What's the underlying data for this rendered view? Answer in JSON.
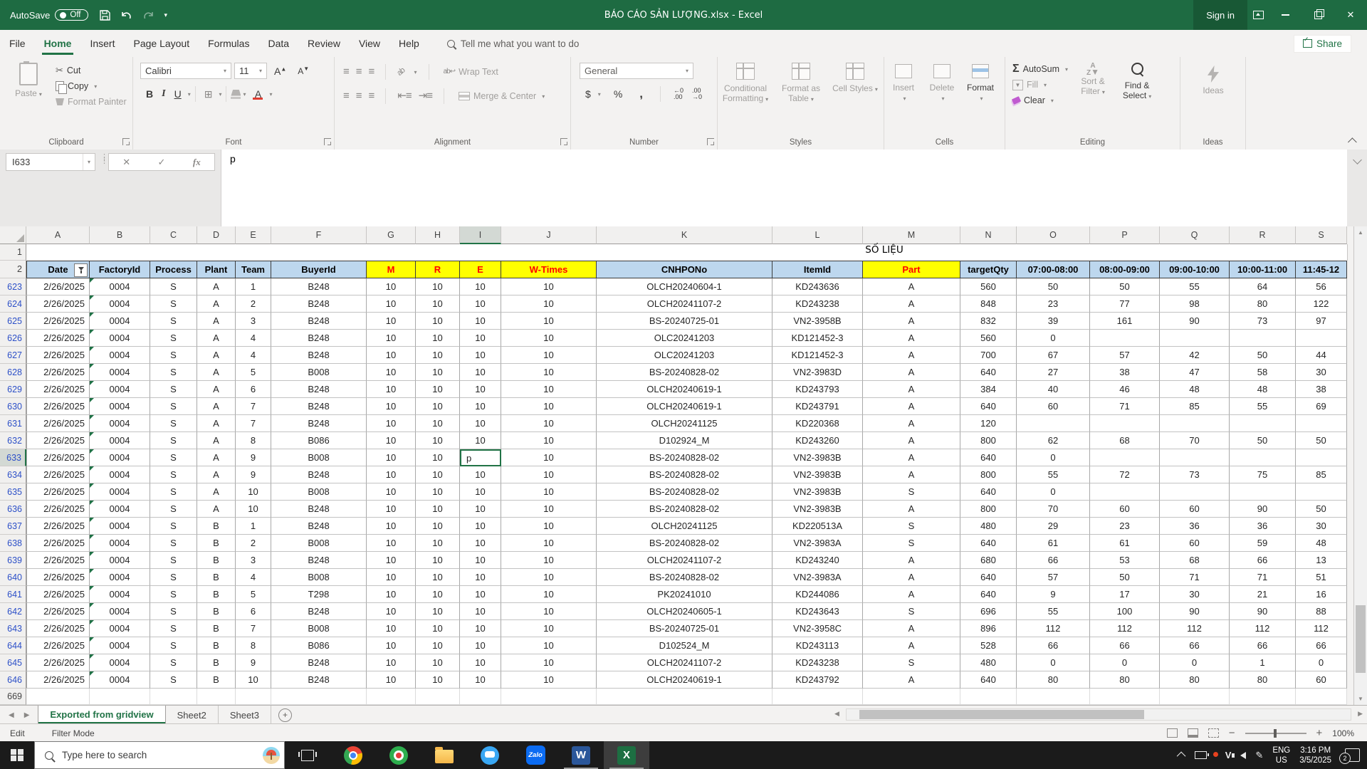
{
  "titlebar": {
    "autosave_label": "AutoSave",
    "autosave_state": "Off",
    "title": "BÁO CÁO SẢN LƯỢNG.xlsx  -  Excel",
    "sign_in": "Sign in"
  },
  "menubar": {
    "tabs": [
      "File",
      "Home",
      "Insert",
      "Page Layout",
      "Formulas",
      "Data",
      "Review",
      "View",
      "Help"
    ],
    "active_tab": "Home",
    "tell_me": "Tell me what you want to do",
    "share": "Share"
  },
  "ribbon": {
    "group_labels": [
      "Clipboard",
      "Font",
      "Alignment",
      "Number",
      "Styles",
      "Cells",
      "Editing",
      "Ideas"
    ],
    "clipboard": {
      "paste": "Paste",
      "cut": "Cut",
      "copy": "Copy",
      "format_painter": "Format Painter"
    },
    "font": {
      "name": "Calibri",
      "size": "11",
      "bold": "B",
      "italic": "I",
      "underline": "U"
    },
    "alignment": {
      "wrap_text": "Wrap Text",
      "merge_center": "Merge & Center"
    },
    "number": {
      "format": "General",
      "currency": "$",
      "percent": "%",
      "comma": ","
    },
    "styles": {
      "conditional": "Conditional Formatting",
      "format_table": "Format as Table",
      "cell_styles": "Cell Styles"
    },
    "cells": {
      "insert": "Insert",
      "delete": "Delete",
      "format": "Format"
    },
    "editing": {
      "autosum": "AutoSum",
      "fill": "Fill",
      "clear": "Clear",
      "sort_filter": "Sort & Filter",
      "find_select": "Find & Select"
    },
    "ideas": {
      "label": "Ideas"
    }
  },
  "formula_bar": {
    "name_box": "I633",
    "fx_label": "fx",
    "content": "p"
  },
  "sheet": {
    "column_letters": [
      "A",
      "B",
      "C",
      "D",
      "E",
      "F",
      "G",
      "H",
      "I",
      "J",
      "K",
      "L",
      "M",
      "N",
      "O",
      "P",
      "Q",
      "R",
      "S"
    ],
    "selected_column": "I",
    "selected_row": "633",
    "row1_number": "1",
    "row2_number": "2",
    "banner": "SỐ LIỆU",
    "headers": [
      {
        "label": "Date",
        "style": "blue",
        "filter": true
      },
      {
        "label": "FactoryId",
        "style": "blue"
      },
      {
        "label": "Process",
        "style": "blue"
      },
      {
        "label": "Plant",
        "style": "blue"
      },
      {
        "label": "Team",
        "style": "blue"
      },
      {
        "label": "BuyerId",
        "style": "blue"
      },
      {
        "label": "M",
        "style": "yellow"
      },
      {
        "label": "R",
        "style": "yellow"
      },
      {
        "label": "E",
        "style": "yellow"
      },
      {
        "label": "W-Times",
        "style": "yellow"
      },
      {
        "label": "CNHPONo",
        "style": "blue"
      },
      {
        "label": "ItemId",
        "style": "blue"
      },
      {
        "label": "Part",
        "style": "yellow"
      },
      {
        "label": "targetQty",
        "style": "blue"
      },
      {
        "label": "07:00-08:00",
        "style": "blue"
      },
      {
        "label": "08:00-09:00",
        "style": "blue"
      },
      {
        "label": "09:00-10:00",
        "style": "blue"
      },
      {
        "label": "10:00-11:00",
        "style": "blue"
      },
      {
        "label": "11:45-12",
        "style": "blue"
      }
    ],
    "rows": [
      [
        "623",
        "2/26/2025",
        "0004",
        "S",
        "A",
        "1",
        "B248",
        "10",
        "10",
        "10",
        "10",
        "OLCH20240604-1",
        "KD243636",
        "A",
        "560",
        "50",
        "50",
        "55",
        "64",
        "56"
      ],
      [
        "624",
        "2/26/2025",
        "0004",
        "S",
        "A",
        "2",
        "B248",
        "10",
        "10",
        "10",
        "10",
        "OLCH20241107-2",
        "KD243238",
        "A",
        "848",
        "23",
        "77",
        "98",
        "80",
        "122"
      ],
      [
        "625",
        "2/26/2025",
        "0004",
        "S",
        "A",
        "3",
        "B248",
        "10",
        "10",
        "10",
        "10",
        "BS-20240725-01",
        "VN2-3958B",
        "A",
        "832",
        "39",
        "161",
        "90",
        "73",
        "97"
      ],
      [
        "626",
        "2/26/2025",
        "0004",
        "S",
        "A",
        "4",
        "B248",
        "10",
        "10",
        "10",
        "10",
        "OLC20241203",
        "KD121452-3",
        "A",
        "560",
        "0",
        "",
        "",
        "",
        ""
      ],
      [
        "627",
        "2/26/2025",
        "0004",
        "S",
        "A",
        "4",
        "B248",
        "10",
        "10",
        "10",
        "10",
        "OLC20241203",
        "KD121452-3",
        "A",
        "700",
        "67",
        "57",
        "42",
        "50",
        "44"
      ],
      [
        "628",
        "2/26/2025",
        "0004",
        "S",
        "A",
        "5",
        "B008",
        "10",
        "10",
        "10",
        "10",
        "BS-20240828-02",
        "VN2-3983D",
        "A",
        "640",
        "27",
        "38",
        "47",
        "58",
        "30"
      ],
      [
        "629",
        "2/26/2025",
        "0004",
        "S",
        "A",
        "6",
        "B248",
        "10",
        "10",
        "10",
        "10",
        "OLCH20240619-1",
        "KD243793",
        "A",
        "384",
        "40",
        "46",
        "48",
        "48",
        "38"
      ],
      [
        "630",
        "2/26/2025",
        "0004",
        "S",
        "A",
        "7",
        "B248",
        "10",
        "10",
        "10",
        "10",
        "OLCH20240619-1",
        "KD243791",
        "A",
        "640",
        "60",
        "71",
        "85",
        "55",
        "69"
      ],
      [
        "631",
        "2/26/2025",
        "0004",
        "S",
        "A",
        "7",
        "B248",
        "10",
        "10",
        "10",
        "10",
        "OLCH20241125",
        "KD220368",
        "A",
        "120",
        "",
        "",
        "",
        "",
        ""
      ],
      [
        "632",
        "2/26/2025",
        "0004",
        "S",
        "A",
        "8",
        "B086",
        "10",
        "10",
        "10",
        "10",
        "D102924_M",
        "KD243260",
        "A",
        "800",
        "62",
        "68",
        "70",
        "50",
        "50"
      ],
      [
        "633",
        "2/26/2025",
        "0004",
        "S",
        "A",
        "9",
        "B008",
        "10",
        "10",
        "p",
        "10",
        "BS-20240828-02",
        "VN2-3983B",
        "A",
        "640",
        "0",
        "",
        "",
        "",
        ""
      ],
      [
        "634",
        "2/26/2025",
        "0004",
        "S",
        "A",
        "9",
        "B248",
        "10",
        "10",
        "10",
        "10",
        "BS-20240828-02",
        "VN2-3983B",
        "A",
        "800",
        "55",
        "72",
        "73",
        "75",
        "85"
      ],
      [
        "635",
        "2/26/2025",
        "0004",
        "S",
        "A",
        "10",
        "B008",
        "10",
        "10",
        "10",
        "10",
        "BS-20240828-02",
        "VN2-3983B",
        "S",
        "640",
        "0",
        "",
        "",
        "",
        ""
      ],
      [
        "636",
        "2/26/2025",
        "0004",
        "S",
        "A",
        "10",
        "B248",
        "10",
        "10",
        "10",
        "10",
        "BS-20240828-02",
        "VN2-3983B",
        "A",
        "800",
        "70",
        "60",
        "60",
        "90",
        "50"
      ],
      [
        "637",
        "2/26/2025",
        "0004",
        "S",
        "B",
        "1",
        "B248",
        "10",
        "10",
        "10",
        "10",
        "OLCH20241125",
        "KD220513A",
        "S",
        "480",
        "29",
        "23",
        "36",
        "36",
        "30"
      ],
      [
        "638",
        "2/26/2025",
        "0004",
        "S",
        "B",
        "2",
        "B008",
        "10",
        "10",
        "10",
        "10",
        "BS-20240828-02",
        "VN2-3983A",
        "S",
        "640",
        "61",
        "61",
        "60",
        "59",
        "48"
      ],
      [
        "639",
        "2/26/2025",
        "0004",
        "S",
        "B",
        "3",
        "B248",
        "10",
        "10",
        "10",
        "10",
        "OLCH20241107-2",
        "KD243240",
        "A",
        "680",
        "66",
        "53",
        "68",
        "66",
        "13"
      ],
      [
        "640",
        "2/26/2025",
        "0004",
        "S",
        "B",
        "4",
        "B008",
        "10",
        "10",
        "10",
        "10",
        "BS-20240828-02",
        "VN2-3983A",
        "A",
        "640",
        "57",
        "50",
        "71",
        "71",
        "51"
      ],
      [
        "641",
        "2/26/2025",
        "0004",
        "S",
        "B",
        "5",
        "T298",
        "10",
        "10",
        "10",
        "10",
        "PK20241010",
        "KD244086",
        "A",
        "640",
        "9",
        "17",
        "30",
        "21",
        "16"
      ],
      [
        "642",
        "2/26/2025",
        "0004",
        "S",
        "B",
        "6",
        "B248",
        "10",
        "10",
        "10",
        "10",
        "OLCH20240605-1",
        "KD243643",
        "S",
        "696",
        "55",
        "100",
        "90",
        "90",
        "88"
      ],
      [
        "643",
        "2/26/2025",
        "0004",
        "S",
        "B",
        "7",
        "B008",
        "10",
        "10",
        "10",
        "10",
        "BS-20240725-01",
        "VN2-3958C",
        "A",
        "896",
        "112",
        "112",
        "112",
        "112",
        "112"
      ],
      [
        "644",
        "2/26/2025",
        "0004",
        "S",
        "B",
        "8",
        "B086",
        "10",
        "10",
        "10",
        "10",
        "D102524_M",
        "KD243113",
        "A",
        "528",
        "66",
        "66",
        "66",
        "66",
        "66"
      ],
      [
        "645",
        "2/26/2025",
        "0004",
        "S",
        "B",
        "9",
        "B248",
        "10",
        "10",
        "10",
        "10",
        "OLCH20241107-2",
        "KD243238",
        "S",
        "480",
        "0",
        "0",
        "0",
        "1",
        "0"
      ],
      [
        "646",
        "2/26/2025",
        "0004",
        "S",
        "B",
        "10",
        "B248",
        "10",
        "10",
        "10",
        "10",
        "OLCH20240619-1",
        "KD243792",
        "A",
        "640",
        "80",
        "80",
        "80",
        "80",
        "60"
      ]
    ],
    "edit_cell": {
      "row": "633",
      "col_index": 9,
      "value": "p"
    },
    "trailing_row": "669"
  },
  "sheet_tabs": {
    "active": "Exported from gridview",
    "others": [
      "Sheet2",
      "Sheet3"
    ]
  },
  "status_bar": {
    "mode": "Edit",
    "filter_mode": "Filter Mode",
    "zoom": "100%"
  },
  "taskbar": {
    "search_placeholder": "Type here to search",
    "zalo_label": "Zalo",
    "word_letter": "W",
    "excel_letter": "X",
    "unikey_letter": "V",
    "lang_line1": "ENG",
    "lang_line2": "US",
    "time": "3:16 PM",
    "date": "3/5/2025",
    "notification_count": "2"
  },
  "colors": {
    "accent_green": "#217346",
    "header_blue": "#BDD7EE",
    "header_yellow": "#FFFF00",
    "header_red_text": "#FF0000"
  }
}
